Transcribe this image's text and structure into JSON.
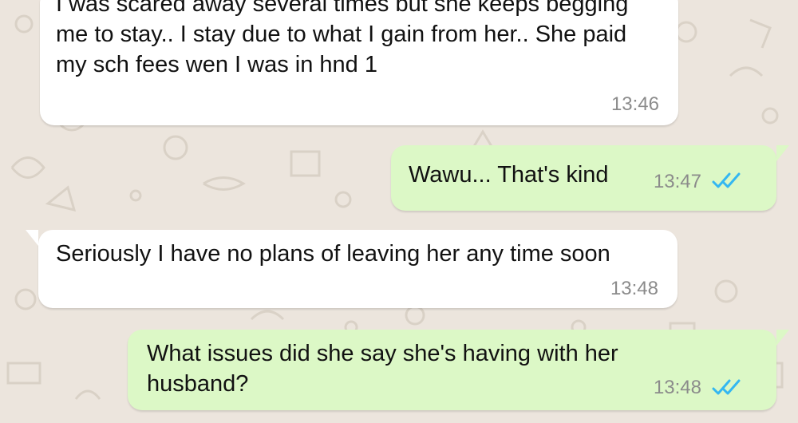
{
  "conversation": {
    "messages": [
      {
        "text": "I was scared away several times but she keeps begging me to stay..  I stay due to what I gain from her.. She paid my sch fees wen I was in hnd 1",
        "time": "13:46"
      },
      {
        "text": "Wawu... That's kind",
        "time": "13:47",
        "status_icon": "double-check-icon"
      },
      {
        "text": "Seriously I have no plans of leaving her any time soon",
        "time": "13:48"
      },
      {
        "text": "What issues did she say she's having with her husband?",
        "time": "13:48",
        "status_icon": "double-check-icon"
      }
    ]
  },
  "colors": {
    "background": "#ece5dd",
    "incoming_bubble": "#ffffff",
    "outgoing_bubble": "#dcf8c6",
    "timestamp": "#8b8b8b",
    "read_ticks": "#34b7f1"
  }
}
